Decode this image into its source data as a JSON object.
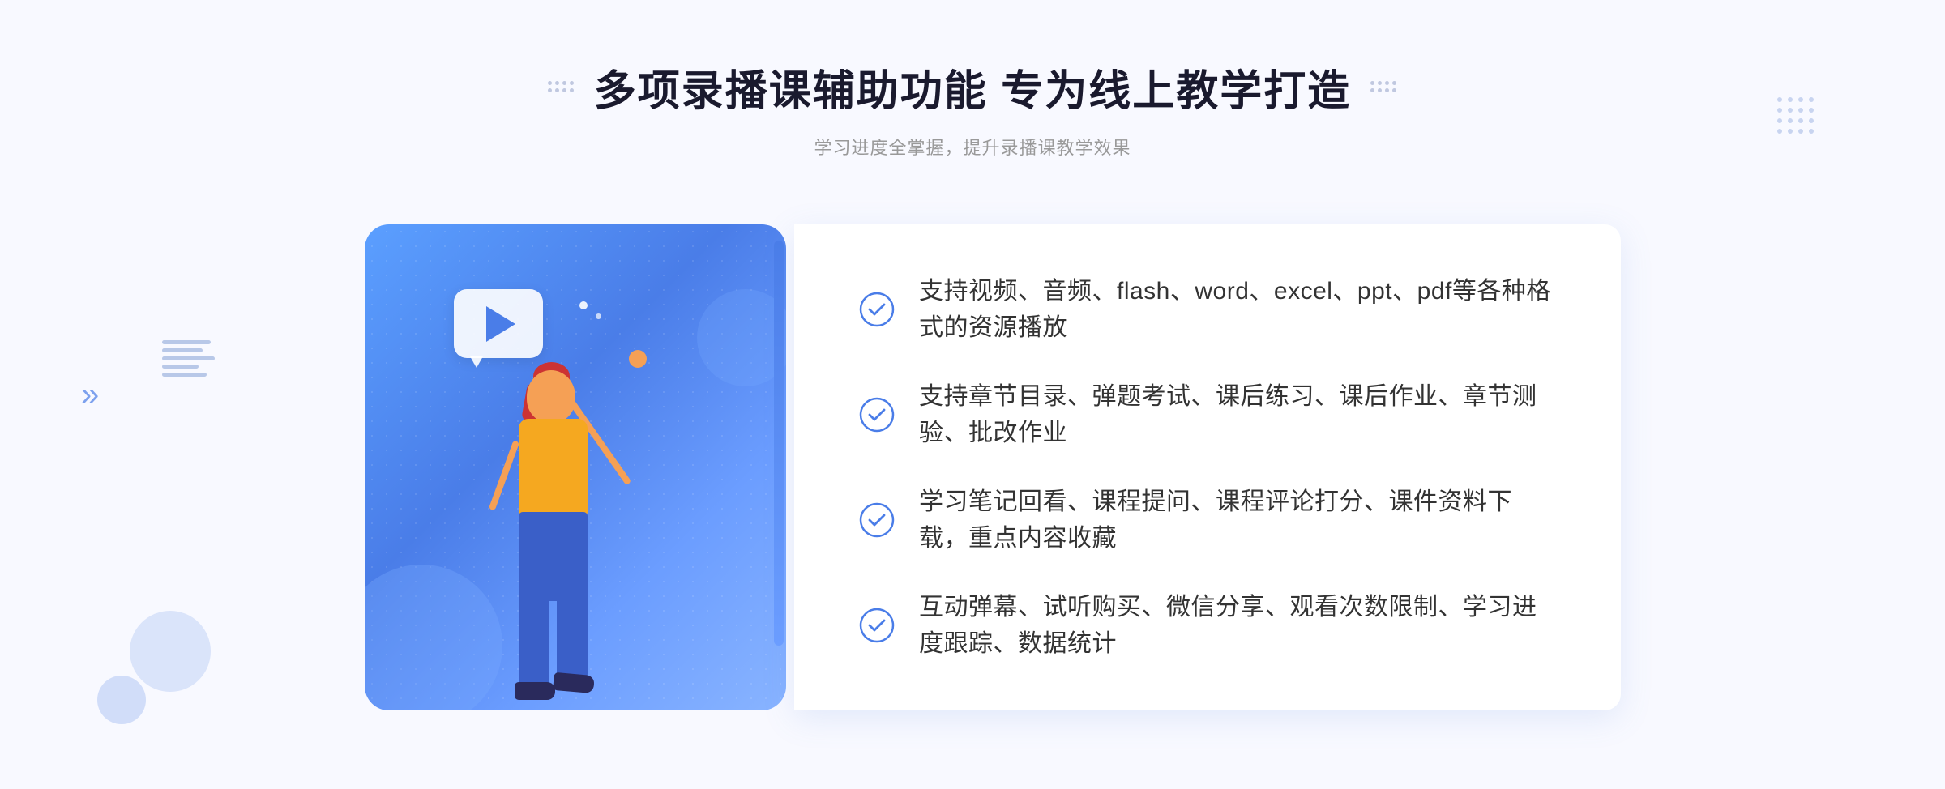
{
  "page": {
    "title": "多项录播课辅助功能 专为线上教学打造",
    "subtitle": "学习进度全掌握，提升录播课教学效果",
    "features": [
      {
        "id": 1,
        "text": "支持视频、音频、flash、word、excel、ppt、pdf等各种格式的资源播放"
      },
      {
        "id": 2,
        "text": "支持章节目录、弹题考试、课后练习、课后作业、章节测验、批改作业"
      },
      {
        "id": 3,
        "text": "学习笔记回看、课程提问、课程评论打分、课件资料下载，重点内容收藏"
      },
      {
        "id": 4,
        "text": "互动弹幕、试听购买、微信分享、观看次数限制、学习进度跟踪、数据统计"
      }
    ],
    "colors": {
      "primary": "#4a7de8",
      "primaryLight": "#6b9dff",
      "text": "#333333",
      "textLight": "#999999",
      "checkColor": "#4a7de8",
      "bg": "#f8f9ff"
    },
    "decorative": {
      "leftArrow": "»",
      "dotGridHeader": ":::::",
      "dotGridRight": ":::::"
    }
  }
}
